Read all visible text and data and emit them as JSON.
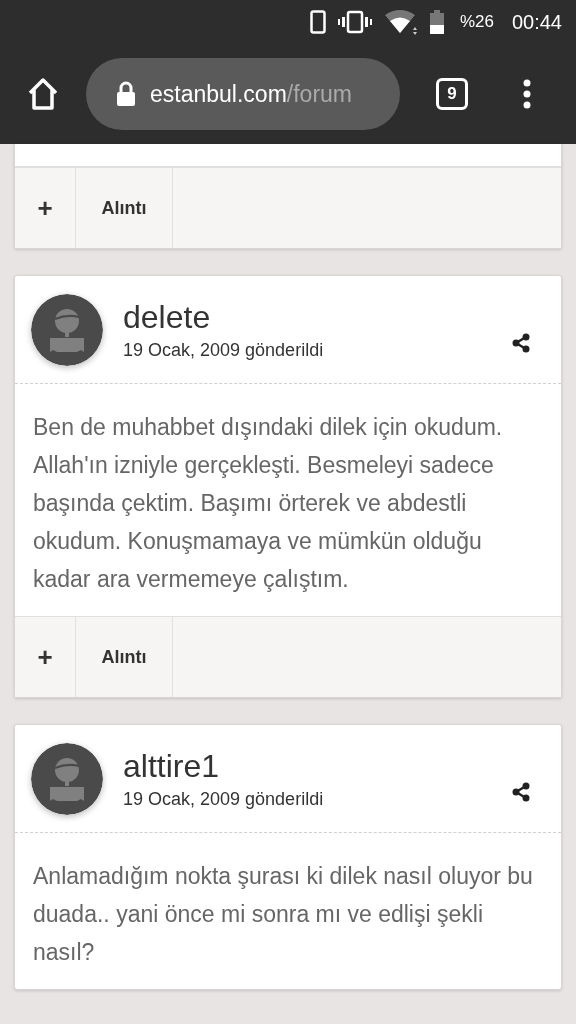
{
  "status_bar": {
    "battery": "%26",
    "time": "00:44"
  },
  "browser": {
    "url_host": "estanbul.com",
    "url_path": "/forum",
    "tab_count": "9"
  },
  "posts": [
    {
      "kind": "partial",
      "actions": {
        "plus": "+",
        "quote": "Alıntı"
      }
    },
    {
      "kind": "full",
      "author": "delete",
      "date": "19 Ocak, 2009 gönderildi",
      "body": "Ben de muhabbet dışındaki dilek için okudum. Allah'ın izniyle gerçekleşti. Besmeleyi sadece başında çektim. Başımı örterek ve abdestli okudum. Konuşmamaya ve mümkün olduğu kadar ara vermemeye çalıştım.",
      "actions": {
        "plus": "+",
        "quote": "Alıntı"
      }
    },
    {
      "kind": "full",
      "author": "alttire1",
      "date": "19 Ocak, 2009 gönderildi",
      "body": "Anlamadığım nokta şurası ki dilek nasıl oluyor bu duada.. yani önce mi sonra mı ve edlişi şekli nasıl?"
    }
  ]
}
